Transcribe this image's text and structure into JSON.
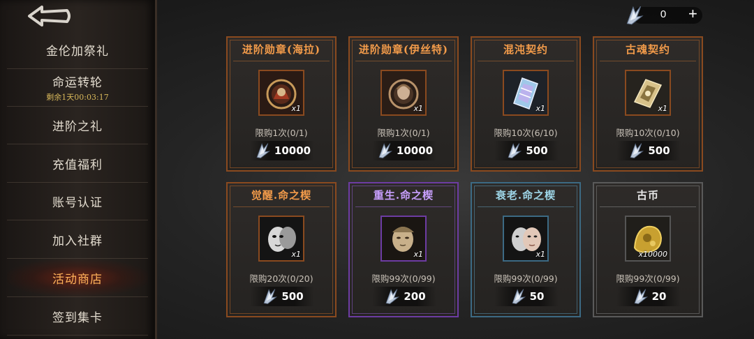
{
  "sidebar": {
    "items": [
      {
        "label": "金伦加祭礼"
      },
      {
        "label": "命运转轮",
        "sub": "剩余1天00:03:17"
      },
      {
        "label": "进阶之礼"
      },
      {
        "label": "充值福利"
      },
      {
        "label": "账号认证"
      },
      {
        "label": "加入社群"
      },
      {
        "label": "活动商店"
      },
      {
        "label": "签到集卡"
      }
    ],
    "active_index": 6
  },
  "currency": {
    "value": "0",
    "plus": "+"
  },
  "shop": {
    "cards": [
      {
        "title": "进阶勋章(海拉)",
        "qty": "x1",
        "limit": "限购1次(0/1)",
        "price": "10000",
        "rarity": "orange",
        "item_icon": "medal-hela-icon"
      },
      {
        "title": "进阶勋章(伊丝特)",
        "qty": "x1",
        "limit": "限购1次(0/1)",
        "price": "10000",
        "rarity": "orange",
        "item_icon": "medal-ister-icon"
      },
      {
        "title": "混沌契约",
        "qty": "x1",
        "limit": "限购10次(6/10)",
        "price": "500",
        "rarity": "orange",
        "item_icon": "chaos-contract-icon"
      },
      {
        "title": "古魂契约",
        "qty": "x1",
        "limit": "限购10次(0/10)",
        "price": "500",
        "rarity": "orange",
        "item_icon": "ancient-soul-contract-icon"
      },
      {
        "title": "觉醒.命之楔",
        "qty": "x1",
        "limit": "限购20次(0/20)",
        "price": "500",
        "rarity": "orange",
        "item_icon": "awaken-mask-icon"
      },
      {
        "title": "重生.命之楔",
        "qty": "x1",
        "limit": "限购99次(0/99)",
        "price": "200",
        "rarity": "purple",
        "item_icon": "rebirth-mask-icon"
      },
      {
        "title": "衰老.命之楔",
        "qty": "x1",
        "limit": "限购99次(0/99)",
        "price": "50",
        "rarity": "blue",
        "item_icon": "aging-mask-icon"
      },
      {
        "title": "古币",
        "qty": "x10000",
        "limit": "限购99次(0/99)",
        "price": "20",
        "rarity": "gray",
        "item_icon": "ancient-coin-icon"
      }
    ]
  },
  "colors": {
    "accent_orange": "#f29b4a",
    "active_nav": "#ffb25a",
    "timer": "#d8b85a"
  }
}
